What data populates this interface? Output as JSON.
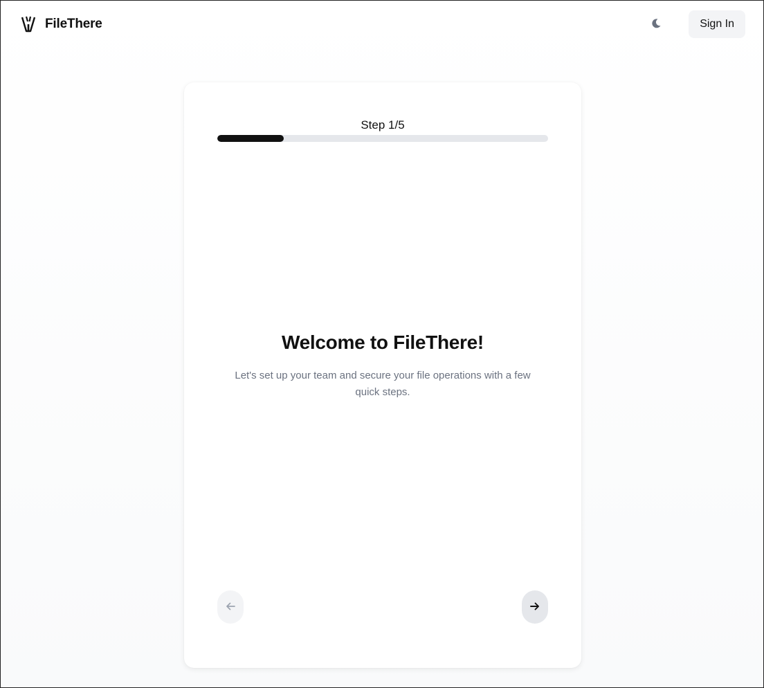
{
  "header": {
    "brand": "FileThere",
    "sign_in_label": "Sign In",
    "theme_icon": "moon-icon",
    "logo_icon": "filethere-logo-icon"
  },
  "onboarding": {
    "step_label": "Step 1/5",
    "progress_fraction": 0.2,
    "title": "Welcome to FileThere!",
    "description": "Let's set up your team and secure your file operations with a few quick steps.",
    "prev_icon": "arrow-left-icon",
    "next_icon": "arrow-right-icon"
  },
  "colors": {
    "accent": "#111111",
    "progress_track": "#e5e7eb",
    "muted_text": "#6b7280",
    "button_bg": "#f3f4f6"
  }
}
